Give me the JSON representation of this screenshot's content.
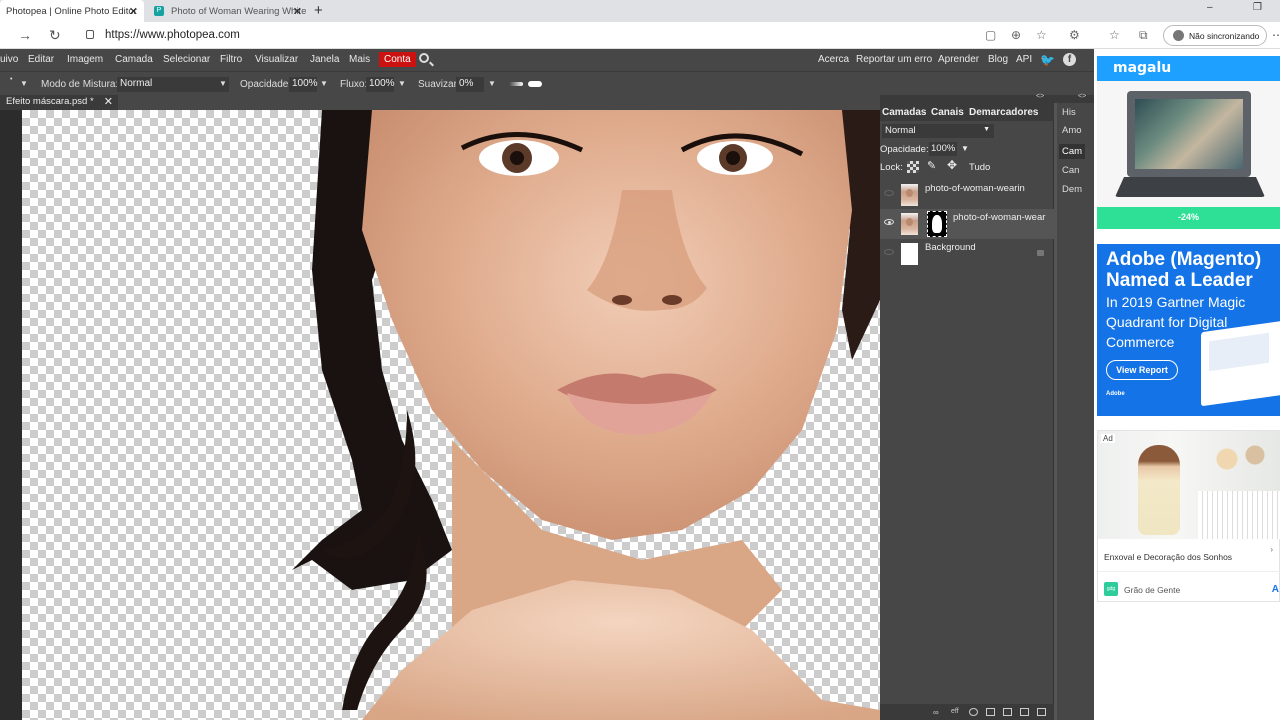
{
  "browser": {
    "tabs": [
      {
        "title": "Photopea | Online Photo Editor",
        "active": true
      },
      {
        "title": "Photo of Woman Wearing White",
        "active": false
      }
    ],
    "url": "https://www.photopea.com",
    "sync_label": "Não sincronizando"
  },
  "menu": {
    "items": [
      "uivo",
      "Editar",
      "Imagem",
      "Camada",
      "Selecionar",
      "Filtro",
      "Visualizar",
      "Janela",
      "Mais"
    ],
    "account": "Conta",
    "right_items": [
      "Acerca",
      "Reportar um erro",
      "Aprender",
      "Blog",
      "API"
    ]
  },
  "options": {
    "blend_label": "Modo de Mistura:",
    "blend_value": "Normal",
    "opacity_label": "Opacidade:",
    "opacity_value": "100%",
    "flow_label": "Fluxo:",
    "flow_value": "100%",
    "smooth_label": "Suavizar:",
    "smooth_value": "0%"
  },
  "document": {
    "tab_title": "Efeito máscara.psd *"
  },
  "layers_panel": {
    "tabs": [
      "Camadas",
      "Canais",
      "Demarcadores"
    ],
    "blend_mode": "Normal",
    "opacity_label": "Opacidade:",
    "opacity_value": "100%",
    "lock_label": "Lock:",
    "all_label": "Tudo",
    "layers": [
      {
        "name": "photo-of-woman-wearin",
        "visible": false,
        "has_mask": false
      },
      {
        "name": "photo-of-woman-wear",
        "visible": true,
        "has_mask": true
      },
      {
        "name": "Background",
        "visible": false,
        "locked": true
      }
    ]
  },
  "side_panel": {
    "items": [
      "His",
      "Amo",
      "Cam",
      "Can",
      "Dem"
    ],
    "active": "Cam"
  },
  "ads": {
    "magalu": {
      "brand": "magalu",
      "discount": "-24%"
    },
    "adobe": {
      "headline": [
        "Adobe (Magento)",
        "Named a Leader"
      ],
      "sub": [
        "In 2019 Gartner Magic",
        "Quadrant for Digital",
        "Commerce"
      ],
      "cta": "View Report",
      "logo": "Adobe"
    },
    "grao": {
      "tag": "Ad",
      "title": "Enxoval e Decoração dos Sonhos",
      "brand": "Grão de Gente",
      "cta": "A"
    }
  },
  "colors": {
    "photopea_bg": "#474747",
    "account_red": "#cc1111",
    "adobe_blue": "#1473e6",
    "magalu_blue": "#1da0ff"
  }
}
